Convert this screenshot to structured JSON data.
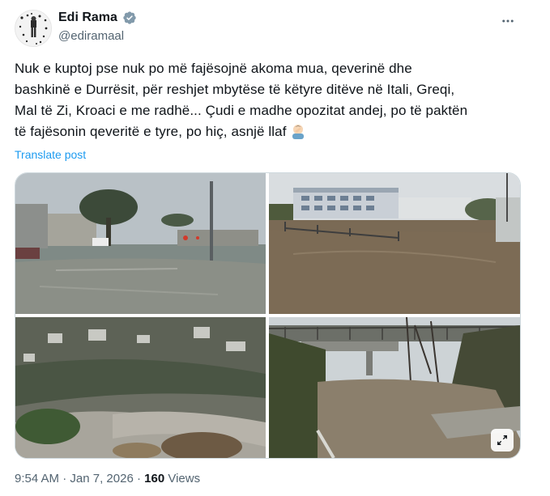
{
  "author": {
    "name": "Edi Rama",
    "handle": "@ediramaal",
    "verified": true,
    "avatar_icon": "avatar-photo-icon"
  },
  "post": {
    "text_lines": [
      "Nuk e kuptoj pse nuk po më fajësojnë akoma mua, qeverinë dhe",
      "bashkinë e Durrësit, për reshjet mbytëse të këtyre ditëve në Itali, Greqi,",
      "Mal të Zi, Kroaci e me radhë... Çudi e madhe opozitat andej, po të paktën",
      "të fajësonin qeveritë e tyre, po hiç, asnjë llaf"
    ],
    "emoji": "man-facepalming",
    "translate_label": "Translate post"
  },
  "media": {
    "photos": [
      {
        "subject": "flooded city street"
      },
      {
        "subject": "flooded parking lot near buildings"
      },
      {
        "subject": "flooded river valley"
      },
      {
        "subject": "flooded road under bridge"
      }
    ],
    "expand_icon": "expand-icon"
  },
  "footer": {
    "time": "9:54 AM",
    "separator": "·",
    "date": "Jan 7, 2026",
    "views_count": "160",
    "views_label": "Views"
  },
  "colors": {
    "link": "#1d9bf0",
    "secondary_text": "#536471",
    "verified_badge": "#829aab"
  }
}
